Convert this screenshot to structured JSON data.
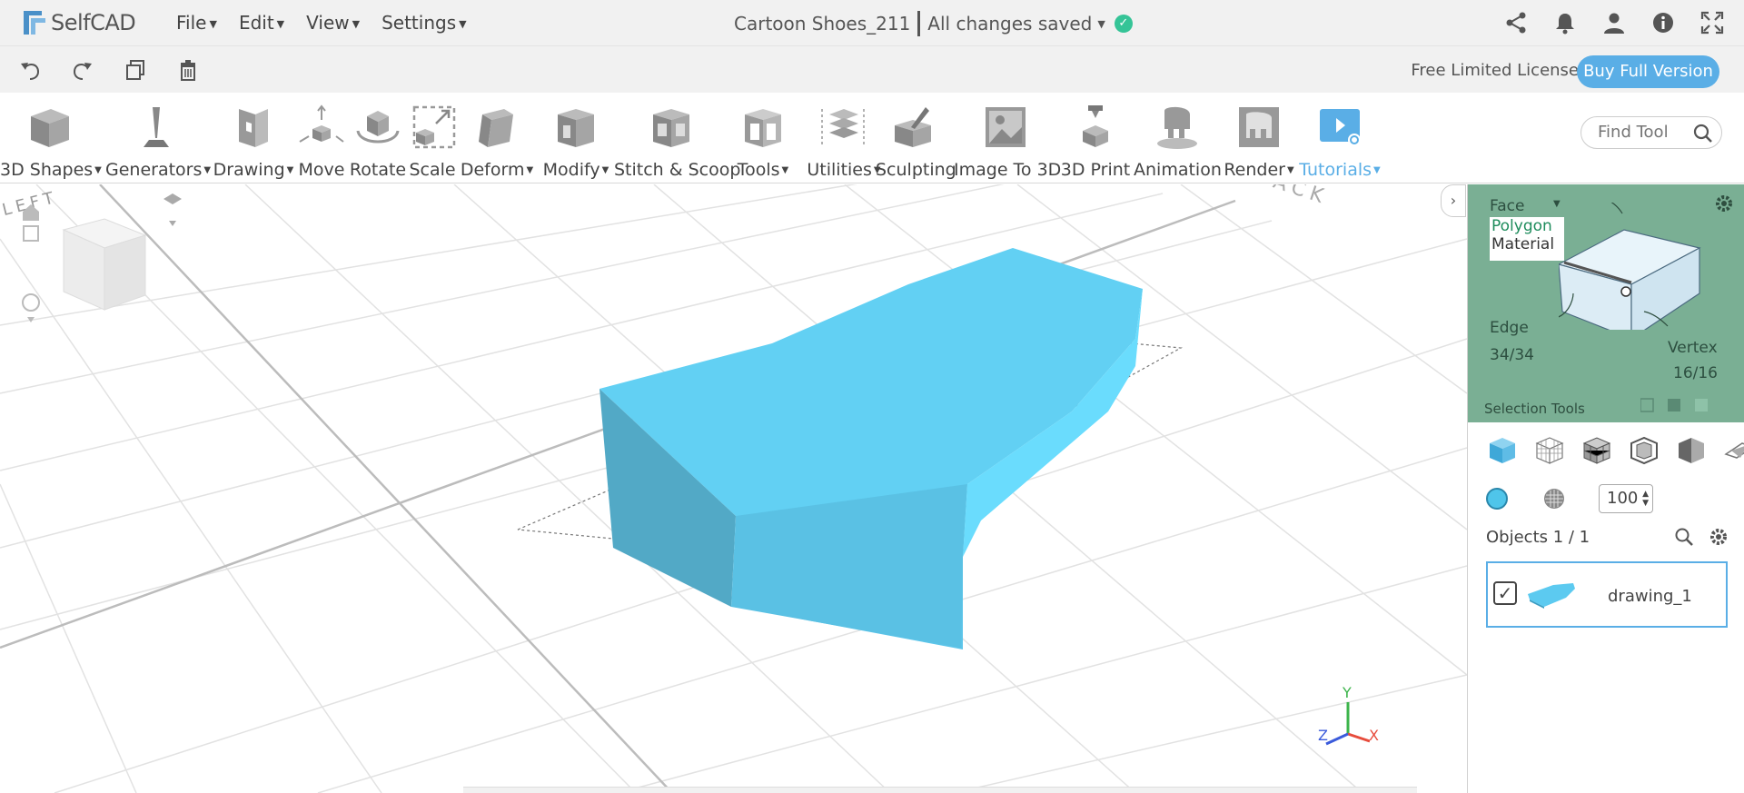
{
  "app": {
    "logo": "SelfCAD",
    "brand_color": "#5aaee6"
  },
  "menu": {
    "items": [
      {
        "label": "File"
      },
      {
        "label": "Edit"
      },
      {
        "label": "View"
      },
      {
        "label": "Settings"
      }
    ]
  },
  "document": {
    "title": "Cartoon Shoes_211",
    "save_status": "All changes saved"
  },
  "top_icons": [
    "share-icon",
    "bell-icon",
    "user-icon",
    "info-icon",
    "fullscreen-icon"
  ],
  "subbar": {
    "actions": [
      "undo-icon",
      "redo-icon",
      "copy-icon",
      "trash-icon"
    ],
    "license": "Free Limited License",
    "buy_label": "Buy Full Version"
  },
  "toolbar": {
    "tools": [
      {
        "label": "3D Shapes",
        "dropdown": true
      },
      {
        "label": "Generators",
        "dropdown": true
      },
      {
        "label": "Drawing",
        "dropdown": true
      },
      {
        "label": "Move",
        "dropdown": false
      },
      {
        "label": "Rotate",
        "dropdown": false
      },
      {
        "label": "Scale",
        "dropdown": false
      },
      {
        "label": "Deform",
        "dropdown": true
      },
      {
        "label": "Modify",
        "dropdown": true
      },
      {
        "label": "Stitch & Scoop",
        "dropdown": false
      },
      {
        "label": "Tools",
        "dropdown": true
      },
      {
        "label": "Utilities",
        "dropdown": true
      },
      {
        "label": "Sculpting",
        "dropdown": false
      },
      {
        "label": "Image To 3D",
        "dropdown": false
      },
      {
        "label": "3D Print",
        "dropdown": false
      },
      {
        "label": "Animation",
        "dropdown": false
      },
      {
        "label": "Render",
        "dropdown": true
      },
      {
        "label": "Tutorials",
        "dropdown": true
      }
    ],
    "find_placeholder": "Find Tool"
  },
  "viewport": {
    "cube_labels": {
      "left": "LEFT",
      "back": "BACK"
    },
    "axes": {
      "y": "Y",
      "x": "X",
      "z": "Z"
    },
    "object_color": "#6dd3f2"
  },
  "selection_tools": {
    "face": "Face",
    "polygon": "Polygon",
    "material": "Material",
    "edge": "Edge",
    "edge_count": "34/34",
    "vertex": "Vertex",
    "vertex_count": "16/16",
    "footer": "Selection Tools"
  },
  "objects_panel": {
    "opacity": "100",
    "header": "Objects 1 / 1",
    "items": [
      {
        "name": "drawing_1",
        "checked": true
      }
    ]
  }
}
